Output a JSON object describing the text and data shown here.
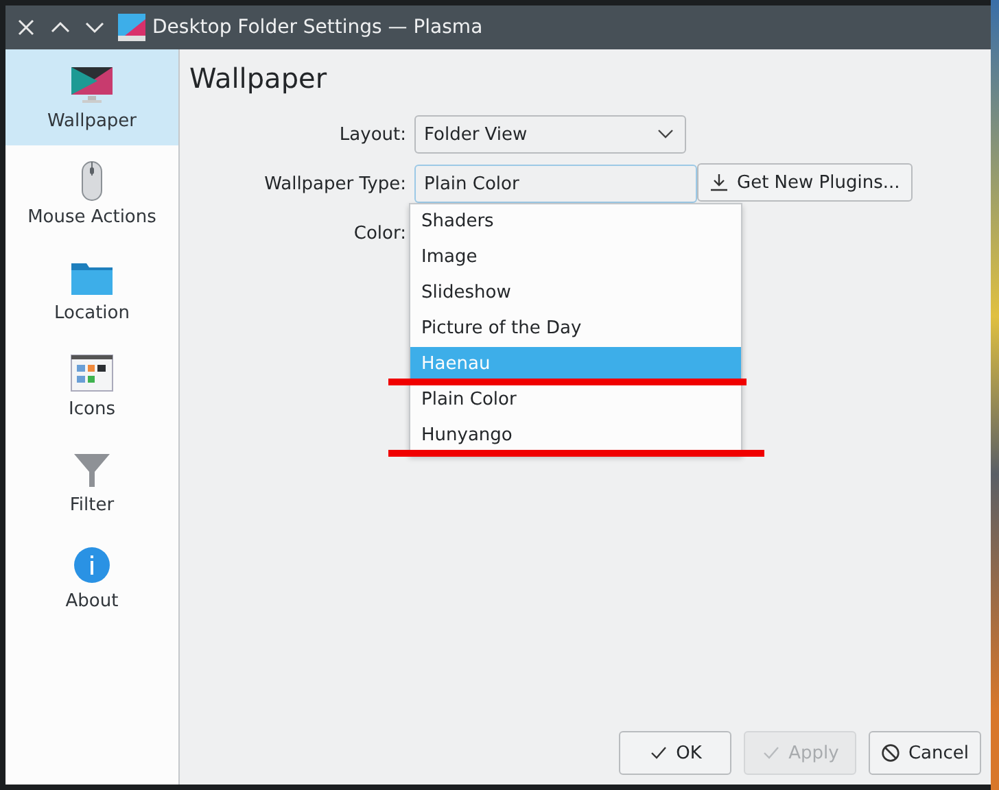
{
  "window": {
    "title": "Desktop Folder Settings — Plasma"
  },
  "sidebar": {
    "items": [
      {
        "label": "Wallpaper",
        "selected": true
      },
      {
        "label": "Mouse Actions",
        "selected": false
      },
      {
        "label": "Location",
        "selected": false
      },
      {
        "label": "Icons",
        "selected": false
      },
      {
        "label": "Filter",
        "selected": false
      },
      {
        "label": "About",
        "selected": false
      }
    ]
  },
  "page": {
    "title": "Wallpaper"
  },
  "form": {
    "layout": {
      "label": "Layout:",
      "value": "Folder View"
    },
    "wallpaper_type": {
      "label": "Wallpaper Type:",
      "value": "Plain Color",
      "plugins_button": "Get New Plugins..."
    },
    "color": {
      "label": "Color:"
    }
  },
  "dropdown": {
    "items": [
      {
        "label": "Shaders",
        "selected": false,
        "underlined": false
      },
      {
        "label": "Image",
        "selected": false,
        "underlined": false
      },
      {
        "label": "Slideshow",
        "selected": false,
        "underlined": false
      },
      {
        "label": "Picture of the Day",
        "selected": false,
        "underlined": false
      },
      {
        "label": "Haenau",
        "selected": true,
        "underlined": true
      },
      {
        "label": "Plain Color",
        "selected": false,
        "underlined": false
      },
      {
        "label": "Hunyango",
        "selected": false,
        "underlined": true
      }
    ]
  },
  "buttons": [
    {
      "label": "OK",
      "disabled": false
    },
    {
      "label": "Apply",
      "disabled": true
    },
    {
      "label": "Cancel",
      "disabled": false
    }
  ]
}
